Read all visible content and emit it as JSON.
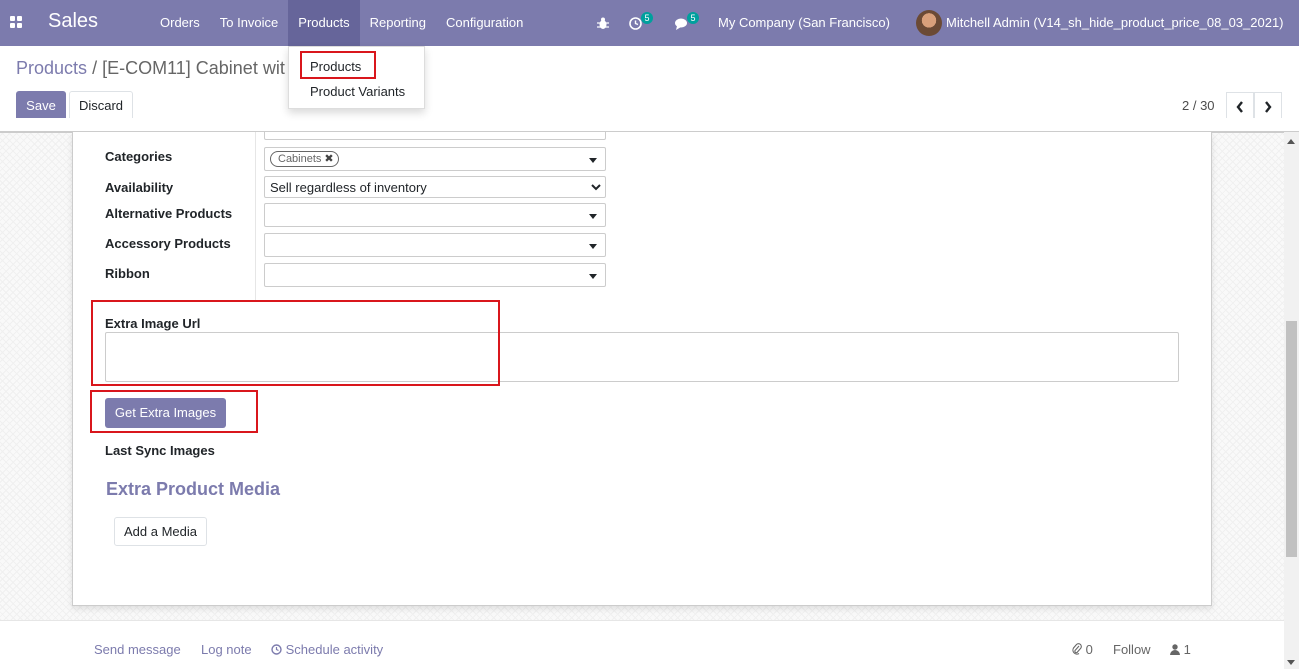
{
  "navbar": {
    "brand": "Sales",
    "menu": [
      {
        "label": "Orders"
      },
      {
        "label": "To Invoice"
      },
      {
        "label": "Products"
      },
      {
        "label": "Reporting"
      },
      {
        "label": "Configuration"
      }
    ],
    "activity_count": "5",
    "message_count": "5",
    "company": "My Company (San Francisco)",
    "user": "Mitchell Admin (V14_sh_hide_product_price_08_03_2021)",
    "icons": {
      "apps": "apps-grid-icon",
      "debug": "bug-icon",
      "activity": "clock-icon",
      "messages": "chat-icon"
    }
  },
  "dropdown": {
    "items": [
      {
        "label": "Products"
      },
      {
        "label": "Product Variants"
      }
    ]
  },
  "control_panel": {
    "breadcrumb_root": "Products",
    "breadcrumb_sep": "/",
    "breadcrumb_current": "[E-COM11] Cabinet wit",
    "save_label": "Save",
    "discard_label": "Discard",
    "pager": "2 / 30"
  },
  "form": {
    "fields": [
      {
        "label": "Categories",
        "tag": "Cabinets"
      },
      {
        "label": "Availability",
        "value": "Sell regardless of inventory"
      },
      {
        "label": "Alternative Products",
        "value": ""
      },
      {
        "label": "Accessory Products",
        "value": ""
      },
      {
        "label": "Ribbon",
        "value": ""
      }
    ],
    "extra_image_url_label": "Extra Image Url",
    "extra_image_url_value": "",
    "get_extra_images_label": "Get Extra Images",
    "last_sync_label": "Last Sync Images",
    "media_section_title": "Extra Product Media",
    "add_media_label": "Add a Media"
  },
  "chatter": {
    "send_message": "Send message",
    "log_note": "Log note",
    "schedule_activity": "Schedule activity",
    "attachments_count": "0",
    "follow": "Follow",
    "followers_count": "1"
  },
  "colors": {
    "brand": "#7c7bad",
    "highlight": "#d9161c",
    "badge": "#00a09d"
  }
}
